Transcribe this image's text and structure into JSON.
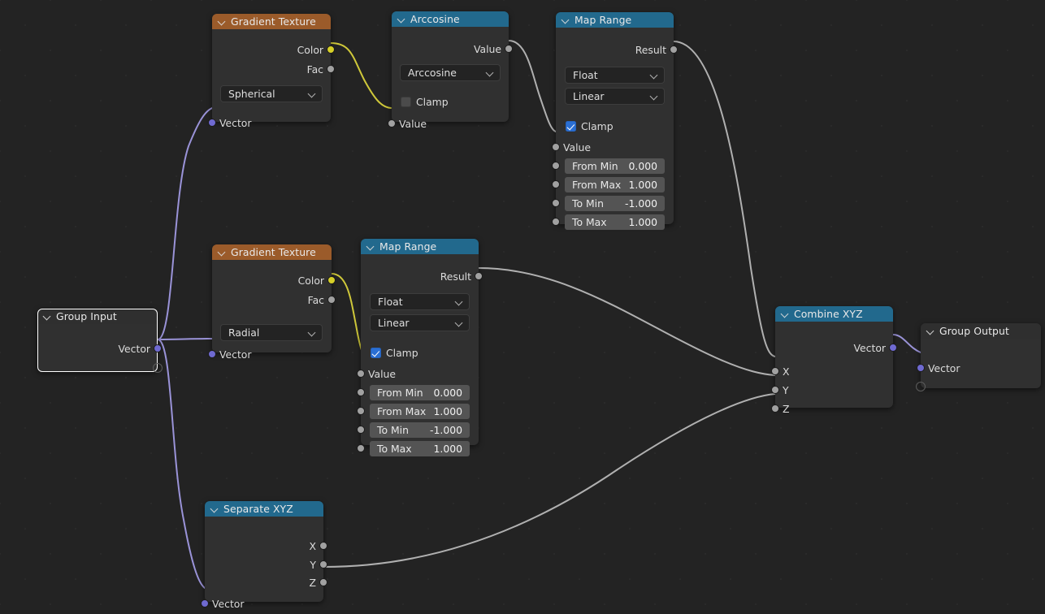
{
  "app": "blender-shader-node-editor",
  "colors": {
    "background": "#232323",
    "node_body": "#303030",
    "header_blue": "#22698d",
    "header_brown": "#9b5b2a",
    "header_gray": "#2f2f2f",
    "socket_vector": "#6f6ad1",
    "socket_value": "#a1a1a1",
    "socket_color": "#d6cf28",
    "link_vector": "#9a93d8",
    "link_value": "#b0b0b0",
    "link_color": "#cfc83a",
    "field": "#545454",
    "checkbox_on": "#2a6fd4"
  },
  "nodes": {
    "gradient_spherical": {
      "title": "Gradient Texture",
      "outputs": [
        {
          "label": "Color",
          "type": "color"
        },
        {
          "label": "Fac",
          "type": "value"
        }
      ],
      "dropdown": "Spherical",
      "inputs": [
        {
          "label": "Vector",
          "type": "vector"
        }
      ]
    },
    "arccosine": {
      "title": "Arccosine",
      "outputs": [
        {
          "label": "Value",
          "type": "value"
        }
      ],
      "dropdown": "Arccosine",
      "clamp_label": "Clamp",
      "clamp_checked": false,
      "inputs": [
        {
          "label": "Value",
          "type": "value"
        }
      ]
    },
    "map_range_top": {
      "title": "Map Range",
      "outputs": [
        {
          "label": "Result",
          "type": "value"
        }
      ],
      "data_type": "Float",
      "interpolation": "Linear",
      "clamp_label": "Clamp",
      "clamp_checked": true,
      "value_label": "Value",
      "fields": [
        {
          "label": "From Min",
          "value": "0.000"
        },
        {
          "label": "From Max",
          "value": "1.000"
        },
        {
          "label": "To Min",
          "value": "-1.000"
        },
        {
          "label": "To Max",
          "value": "1.000"
        }
      ]
    },
    "gradient_radial": {
      "title": "Gradient Texture",
      "outputs": [
        {
          "label": "Color",
          "type": "color"
        },
        {
          "label": "Fac",
          "type": "value"
        }
      ],
      "dropdown": "Radial",
      "inputs": [
        {
          "label": "Vector",
          "type": "vector"
        }
      ]
    },
    "map_range_mid": {
      "title": "Map Range",
      "outputs": [
        {
          "label": "Result",
          "type": "value"
        }
      ],
      "data_type": "Float",
      "interpolation": "Linear",
      "clamp_label": "Clamp",
      "clamp_checked": true,
      "value_label": "Value",
      "fields": [
        {
          "label": "From Min",
          "value": "0.000"
        },
        {
          "label": "From Max",
          "value": "1.000"
        },
        {
          "label": "To Min",
          "value": "-1.000"
        },
        {
          "label": "To Max",
          "value": "1.000"
        }
      ]
    },
    "group_input": {
      "title": "Group Input",
      "selected": true,
      "outputs": [
        {
          "label": "Vector",
          "type": "vector"
        }
      ],
      "virtual_socket": ""
    },
    "separate_xyz": {
      "title": "Separate XYZ",
      "outputs": [
        {
          "label": "X",
          "type": "value"
        },
        {
          "label": "Y",
          "type": "value"
        },
        {
          "label": "Z",
          "type": "value"
        }
      ],
      "inputs": [
        {
          "label": "Vector",
          "type": "vector"
        }
      ]
    },
    "combine_xyz": {
      "title": "Combine XYZ",
      "outputs": [
        {
          "label": "Vector",
          "type": "vector"
        }
      ],
      "inputs": [
        {
          "label": "X",
          "type": "value"
        },
        {
          "label": "Y",
          "type": "value"
        },
        {
          "label": "Z",
          "type": "value"
        }
      ]
    },
    "group_output": {
      "title": "Group Output",
      "inputs": [
        {
          "label": "Vector",
          "type": "vector"
        }
      ],
      "virtual_socket": ""
    }
  }
}
